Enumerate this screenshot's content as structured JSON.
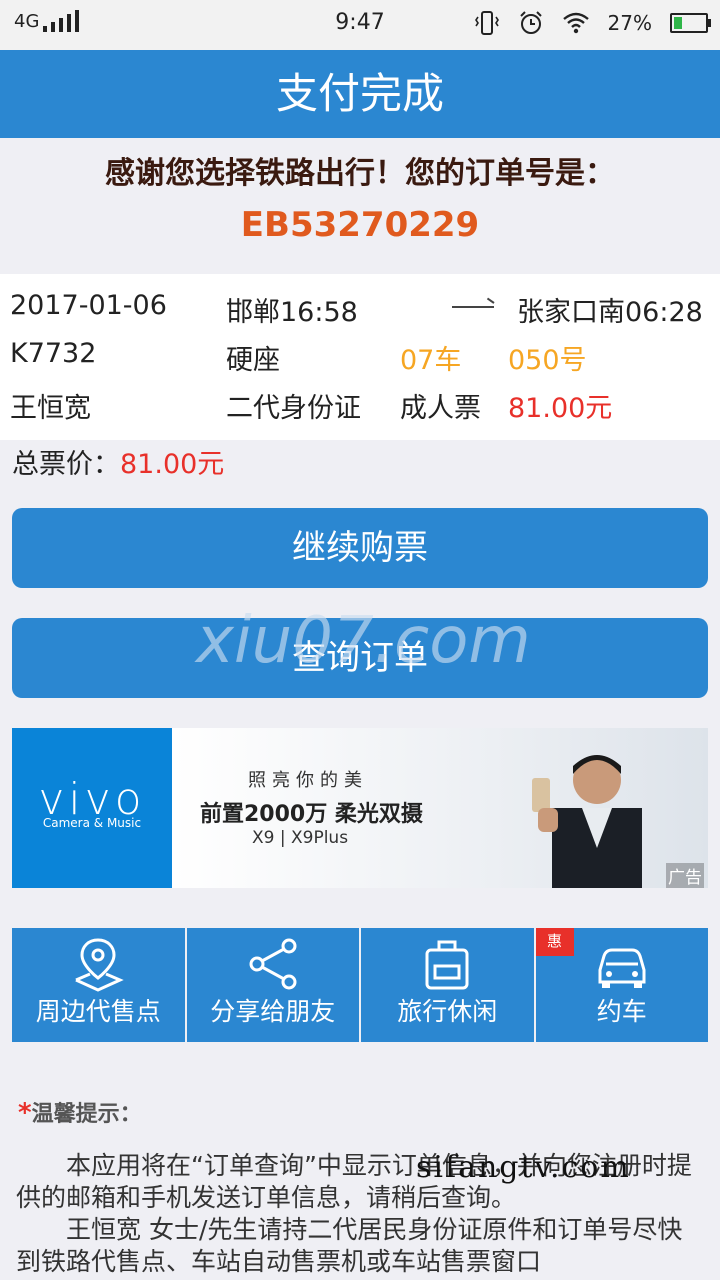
{
  "status": {
    "network": "4G",
    "time": "9:47",
    "battery": "27%",
    "battery_level": 0.27
  },
  "header": {
    "title": "支付完成"
  },
  "confirmation": {
    "thanks": "感谢您选择铁路出行！您的订单号是：",
    "order_no": "EB53270229"
  },
  "ticket": {
    "date": "2017-01-06",
    "from": "邯郸16:58",
    "to": "张家口南06:28",
    "train": "K7732",
    "seat_type": "硬座",
    "car": "07车",
    "seat": "050号",
    "passenger": "王恒宽",
    "id_type": "二代身份证",
    "ticket_type": "成人票",
    "price": "81.00元"
  },
  "total": {
    "label": "总票价：",
    "value": "81.00元"
  },
  "buttons": {
    "continue": "继续购票",
    "query": "查询订单"
  },
  "watermarks": {
    "center": "xiu07.com",
    "bottom": "sifangtv.com"
  },
  "ad": {
    "brand": "vivo",
    "brand_sub": "Camera & Music",
    "line1": "照亮你的美",
    "line2": "前置2000万 柔光双摄",
    "line3": "X9 | X9Plus",
    "tag": "广告"
  },
  "tiles": [
    {
      "label": "周边代售点",
      "icon": "location-pin-icon"
    },
    {
      "label": "分享给朋友",
      "icon": "share-icon"
    },
    {
      "label": "旅行休闲",
      "icon": "luggage-icon"
    },
    {
      "label": "约车",
      "icon": "car-icon",
      "badge": "惠"
    }
  ],
  "tips": {
    "title": "温馨提示：",
    "p1": "本应用将在“订单查询”中显示订单信息，并向您注册时提供的邮箱和手机发送订单信息，请稍后查询。",
    "p2": "王恒宽  女士/先生请持二代居民身份证原件和订单号尽快到铁路代售点、车站自动售票机或车站售票窗口"
  },
  "colors": {
    "primary": "#2b87d1",
    "order_no": "#e05a1e",
    "price": "#e8302a",
    "car_seat": "#f6a623"
  }
}
